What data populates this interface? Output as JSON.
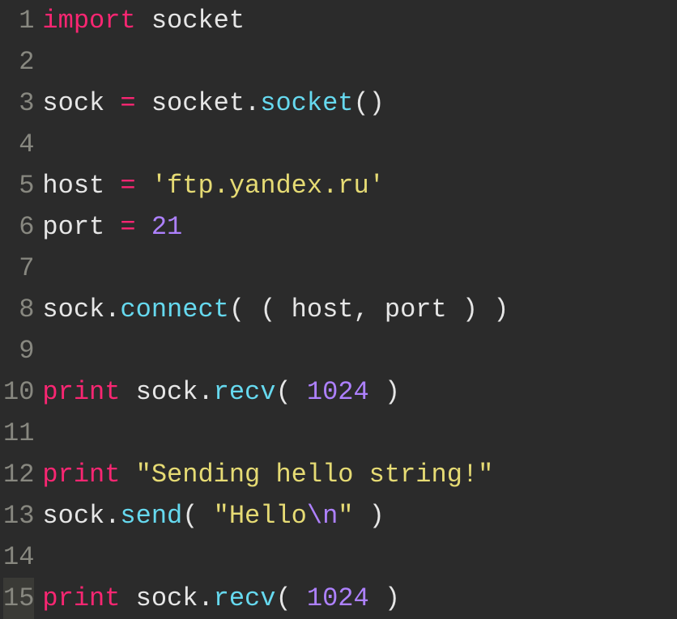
{
  "editor": {
    "current_line": 15,
    "lines": [
      {
        "no": 1,
        "tokens": [
          {
            "cls": "tok-keyword",
            "t": "import"
          },
          {
            "cls": "tok-ident",
            "t": " socket"
          }
        ]
      },
      {
        "no": 2,
        "tokens": []
      },
      {
        "no": 3,
        "tokens": [
          {
            "cls": "tok-ident",
            "t": "sock "
          },
          {
            "cls": "tok-op",
            "t": "="
          },
          {
            "cls": "tok-ident",
            "t": " socket"
          },
          {
            "cls": "tok-punct",
            "t": "."
          },
          {
            "cls": "tok-call",
            "t": "socket"
          },
          {
            "cls": "tok-punct",
            "t": "()"
          }
        ]
      },
      {
        "no": 4,
        "tokens": []
      },
      {
        "no": 5,
        "tokens": [
          {
            "cls": "tok-ident",
            "t": "host "
          },
          {
            "cls": "tok-op",
            "t": "="
          },
          {
            "cls": "tok-ident",
            "t": " "
          },
          {
            "cls": "tok-string",
            "t": "'ftp.yandex.ru'"
          }
        ]
      },
      {
        "no": 6,
        "tokens": [
          {
            "cls": "tok-ident",
            "t": "port "
          },
          {
            "cls": "tok-op",
            "t": "="
          },
          {
            "cls": "tok-ident",
            "t": " "
          },
          {
            "cls": "tok-number",
            "t": "21"
          }
        ]
      },
      {
        "no": 7,
        "tokens": []
      },
      {
        "no": 8,
        "tokens": [
          {
            "cls": "tok-ident",
            "t": "sock"
          },
          {
            "cls": "tok-punct",
            "t": "."
          },
          {
            "cls": "tok-call",
            "t": "connect"
          },
          {
            "cls": "tok-punct",
            "t": "( ( "
          },
          {
            "cls": "tok-ident",
            "t": "host"
          },
          {
            "cls": "tok-punct",
            "t": ", "
          },
          {
            "cls": "tok-ident",
            "t": "port"
          },
          {
            "cls": "tok-punct",
            "t": " ) )"
          }
        ]
      },
      {
        "no": 9,
        "tokens": []
      },
      {
        "no": 10,
        "tokens": [
          {
            "cls": "tok-keyword",
            "t": "print"
          },
          {
            "cls": "tok-ident",
            "t": " sock"
          },
          {
            "cls": "tok-punct",
            "t": "."
          },
          {
            "cls": "tok-call",
            "t": "recv"
          },
          {
            "cls": "tok-punct",
            "t": "( "
          },
          {
            "cls": "tok-number",
            "t": "1024"
          },
          {
            "cls": "tok-punct",
            "t": " )"
          }
        ]
      },
      {
        "no": 11,
        "tokens": []
      },
      {
        "no": 12,
        "tokens": [
          {
            "cls": "tok-keyword",
            "t": "print"
          },
          {
            "cls": "tok-ident",
            "t": " "
          },
          {
            "cls": "tok-string",
            "t": "\"Sending hello string!\""
          }
        ]
      },
      {
        "no": 13,
        "tokens": [
          {
            "cls": "tok-ident",
            "t": "sock"
          },
          {
            "cls": "tok-punct",
            "t": "."
          },
          {
            "cls": "tok-call",
            "t": "send"
          },
          {
            "cls": "tok-punct",
            "t": "( "
          },
          {
            "cls": "tok-string",
            "t": "\"Hello"
          },
          {
            "cls": "tok-escape",
            "t": "\\n"
          },
          {
            "cls": "tok-string",
            "t": "\""
          },
          {
            "cls": "tok-punct",
            "t": " )"
          }
        ]
      },
      {
        "no": 14,
        "tokens": []
      },
      {
        "no": 15,
        "tokens": [
          {
            "cls": "tok-keyword",
            "t": "print"
          },
          {
            "cls": "tok-ident",
            "t": " sock"
          },
          {
            "cls": "tok-punct",
            "t": "."
          },
          {
            "cls": "tok-call",
            "t": "recv"
          },
          {
            "cls": "tok-punct",
            "t": "( "
          },
          {
            "cls": "tok-number",
            "t": "1024"
          },
          {
            "cls": "tok-punct",
            "t": " )"
          }
        ]
      }
    ]
  }
}
